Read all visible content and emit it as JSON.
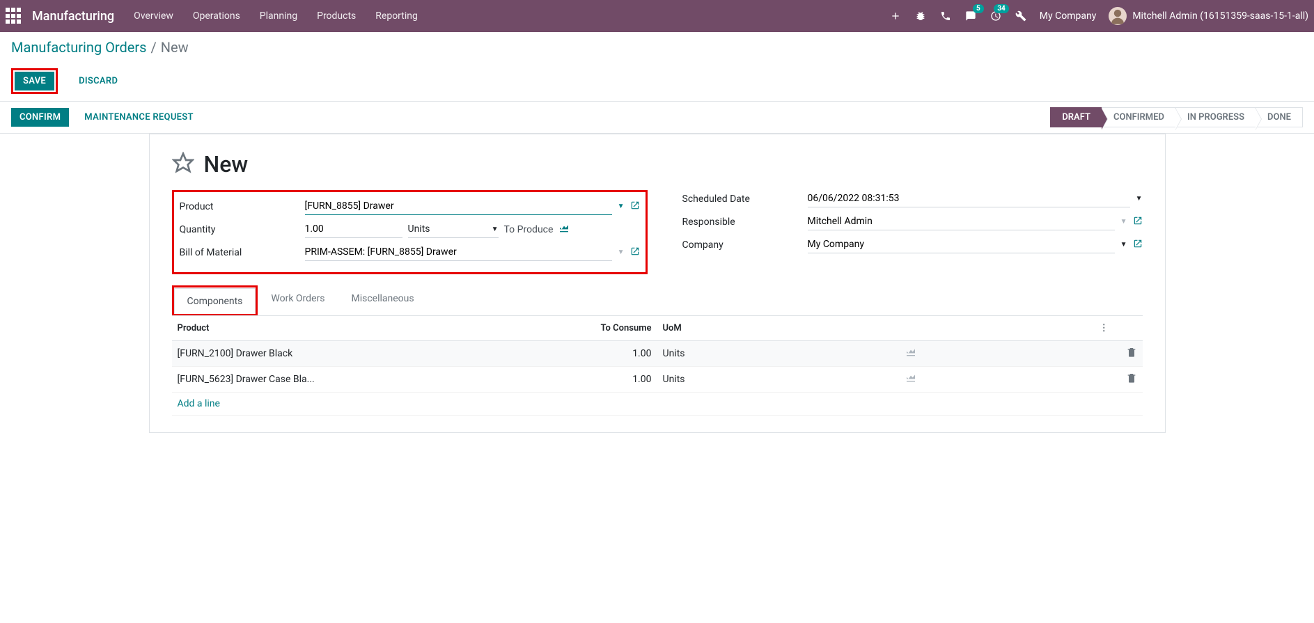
{
  "nav": {
    "app_title": "Manufacturing",
    "menu": [
      "Overview",
      "Operations",
      "Planning",
      "Products",
      "Reporting"
    ],
    "company": "My Company",
    "user": "Mitchell Admin (16151359-saas-15-1-all)",
    "messages_badge": "5",
    "activities_badge": "34"
  },
  "breadcrumb": {
    "parent": "Manufacturing Orders",
    "current": "New"
  },
  "actions": {
    "save": "SAVE",
    "discard": "DISCARD",
    "confirm": "CONFIRM",
    "maintenance": "MAINTENANCE REQUEST"
  },
  "status": {
    "steps": [
      "DRAFT",
      "CONFIRMED",
      "IN PROGRESS",
      "DONE"
    ],
    "active": "DRAFT"
  },
  "form": {
    "title": "New",
    "labels": {
      "product": "Product",
      "quantity": "Quantity",
      "bom": "Bill of Material",
      "scheduled": "Scheduled Date",
      "responsible": "Responsible",
      "company": "Company",
      "to_produce": "To Produce"
    },
    "values": {
      "product": "[FURN_8855] Drawer",
      "quantity": "1.00",
      "units": "Units",
      "bom": "PRIM-ASSEM: [FURN_8855] Drawer",
      "scheduled": "06/06/2022 08:31:53",
      "responsible": "Mitchell Admin",
      "company": "My Company"
    }
  },
  "tabs": {
    "items": [
      "Components",
      "Work Orders",
      "Miscellaneous"
    ],
    "active": "Components"
  },
  "components": {
    "headers": {
      "product": "Product",
      "consume": "To Consume",
      "uom": "UoM"
    },
    "rows": [
      {
        "product": "[FURN_2100] Drawer Black",
        "consume": "1.00",
        "uom": "Units"
      },
      {
        "product": "[FURN_5623] Drawer Case Bla...",
        "consume": "1.00",
        "uom": "Units"
      }
    ],
    "add_line": "Add a line"
  }
}
